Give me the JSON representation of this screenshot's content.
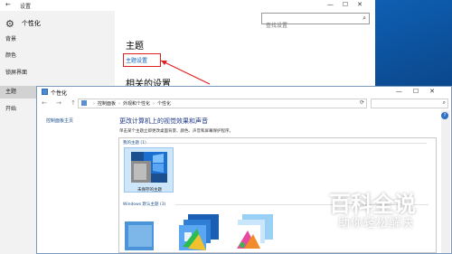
{
  "settings": {
    "title": "设置",
    "header_title": "个性化",
    "search_placeholder": "查找设置",
    "back_icon": "back-arrow-icon",
    "sidebar_items": [
      {
        "label": "背景"
      },
      {
        "label": "颜色"
      },
      {
        "label": "锁屏界面"
      },
      {
        "label": "主题",
        "active": true
      },
      {
        "label": "开始"
      }
    ],
    "main_heading": "主题",
    "theme_settings_link": "主题设置",
    "related_heading": "相关的设置"
  },
  "personalization": {
    "window_title": "个性化",
    "breadcrumbs": [
      "控制面板",
      "外观和个性化",
      "个性化"
    ],
    "left_pane_link": "控制面板主页",
    "heading": "更改计算机上的视觉效果和声音",
    "description": "单击某个主题立即更改桌面背景、颜色、声音和屏幕保护程序。",
    "group_my_themes": "我的主题 (1)",
    "unsaved_theme_label": "未保存的主题",
    "group_windows_default": "Windows 默认主题 (3)",
    "help_label": "?"
  },
  "annotation": {
    "arrow_color": "#e02020",
    "highlight_color": "#e02020"
  },
  "watermark": {
    "title": "百科全说",
    "subtitle": "助你轻松解决"
  },
  "colors": {
    "accent": "#0b5fb8",
    "desktop": "#0b4a8c"
  }
}
